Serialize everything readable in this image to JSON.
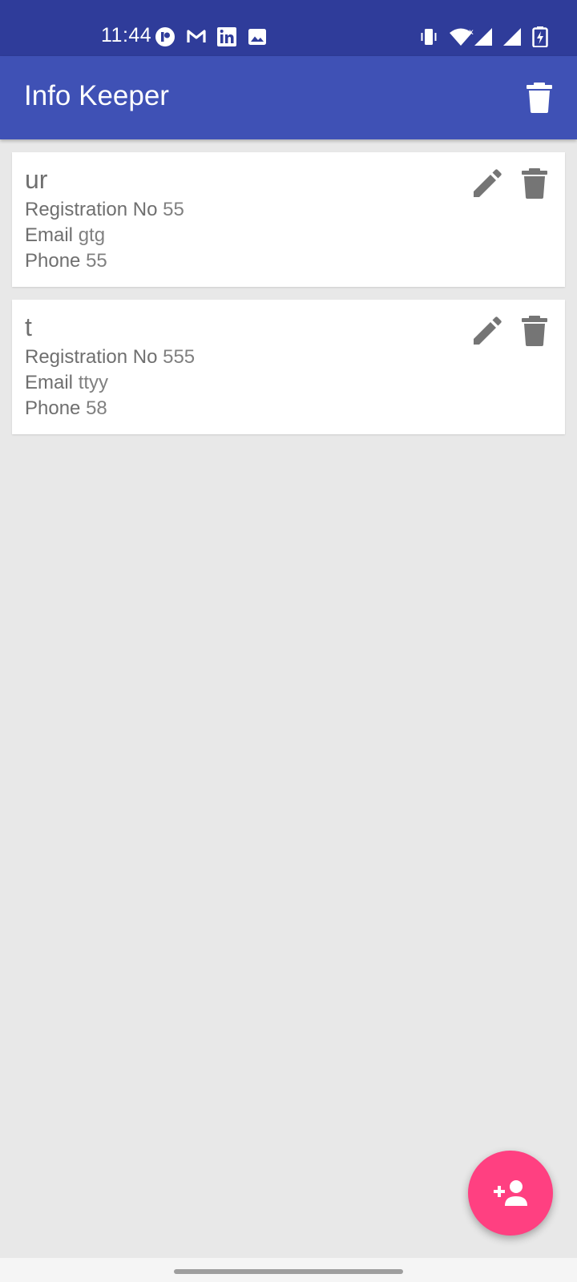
{
  "status_bar": {
    "time": "11:44",
    "notification_icons": [
      "app-r-icon",
      "gmail-icon",
      "linkedin-icon",
      "gallery-icon"
    ],
    "system_icons": [
      "vibrate-icon",
      "wifi-icon",
      "signal-icon",
      "signal-icon",
      "battery-charging-icon"
    ]
  },
  "app_bar": {
    "title": "Info Keeper",
    "action_icon": "delete-all-icon"
  },
  "records": [
    {
      "name": "ur",
      "registration_label": "Registration No",
      "registration_value": "55",
      "email_label": "Email",
      "email_value": "gtg",
      "phone_label": "Phone",
      "phone_value": "55"
    },
    {
      "name": "t",
      "registration_label": "Registration No",
      "registration_value": "555",
      "email_label": "Email",
      "email_value": "ttyy",
      "phone_label": "Phone",
      "phone_value": "58"
    }
  ],
  "fab": {
    "icon": "add-person-icon"
  },
  "colors": {
    "status_bar": "#2f3c9a",
    "app_bar": "#3f51b5",
    "fab": "#ff4081",
    "background": "#e8e8e8",
    "icon_gray": "#757575"
  }
}
